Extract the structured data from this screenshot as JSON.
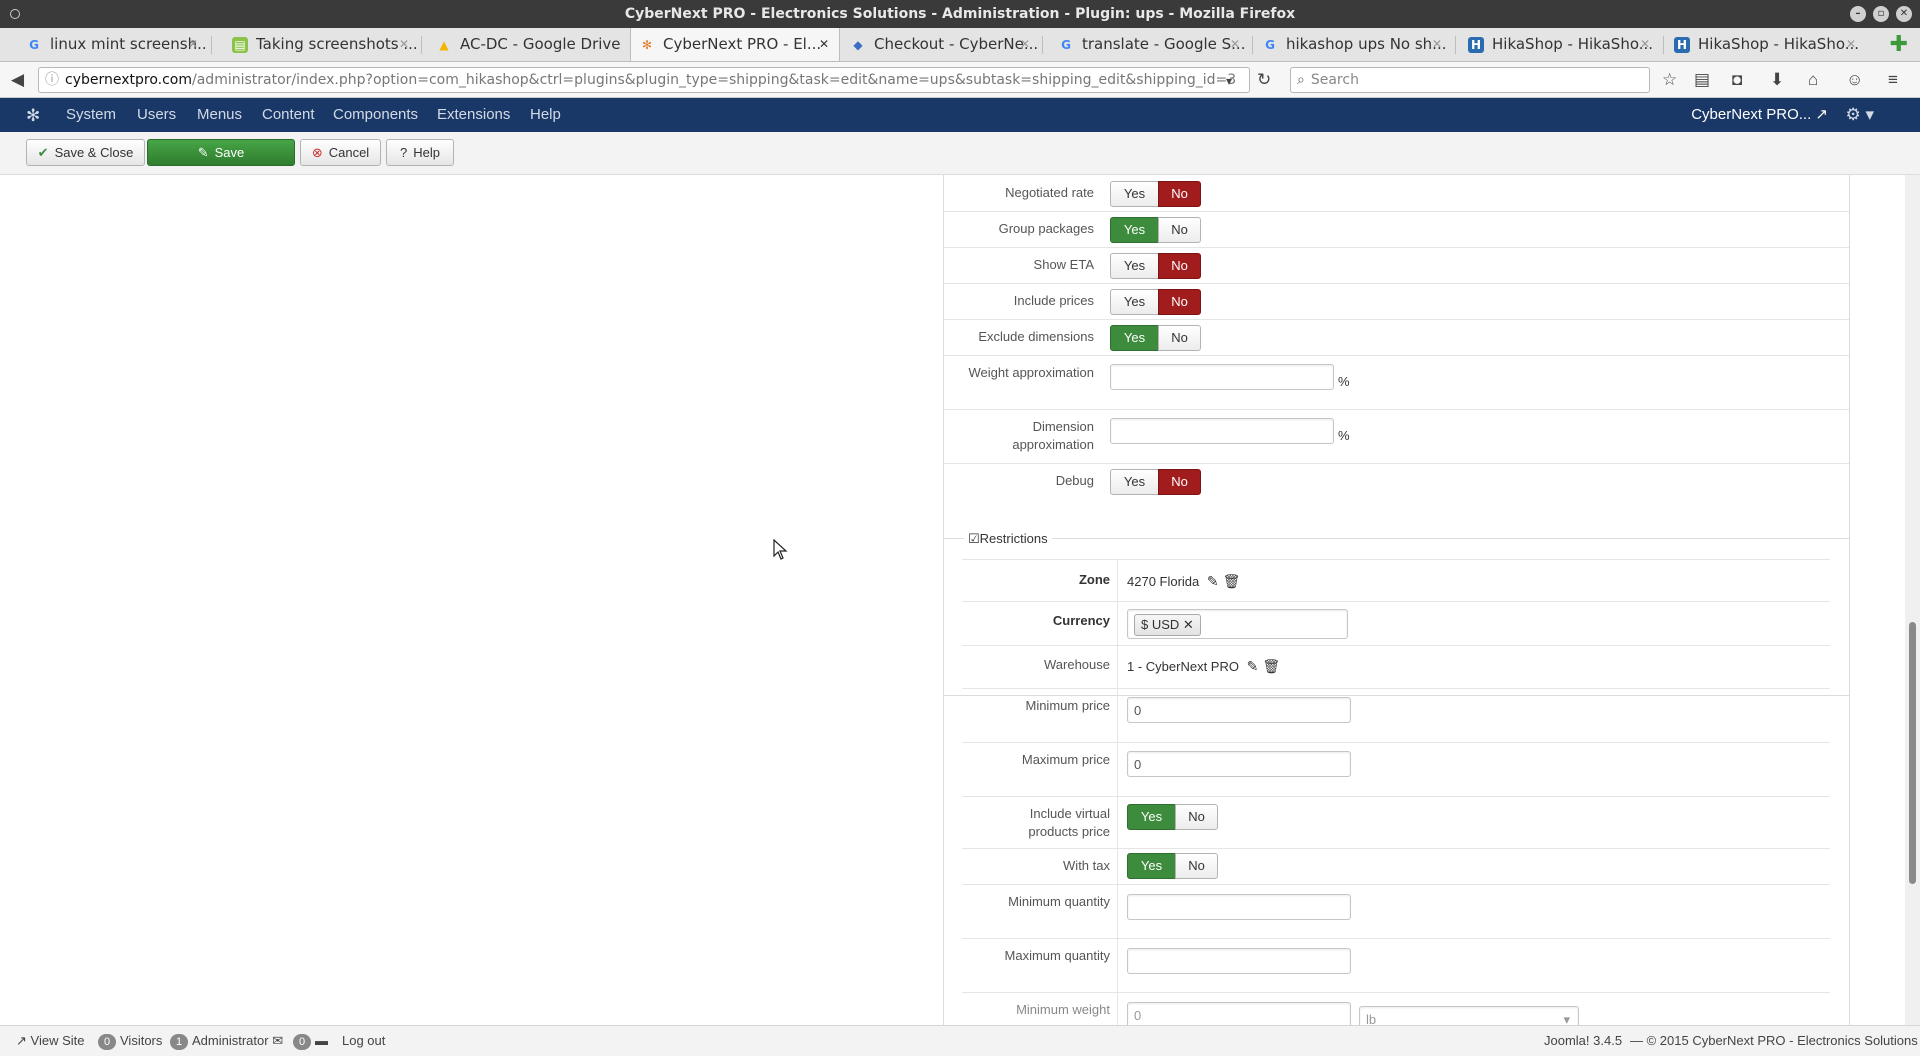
{
  "window": {
    "title": "CyberNext PRO - Electronics Solutions - Administration - Plugin: ups - Mozilla Firefox"
  },
  "tabs": [
    {
      "label": "linux mint screensh...",
      "favicon": "google-icon"
    },
    {
      "label": "Taking screenshots ...",
      "favicon": "page-icon"
    },
    {
      "label": "AC-DC - Google Drive",
      "favicon": "google-drive-icon"
    },
    {
      "label": "CyberNext PRO - El...",
      "favicon": "joomla-icon",
      "active": true
    },
    {
      "label": "Checkout - CyberNe...",
      "favicon": "cube-icon"
    },
    {
      "label": "translate - Google S...",
      "favicon": "google-icon"
    },
    {
      "label": "hikashop ups No sh...",
      "favicon": "google-icon"
    },
    {
      "label": "HikaShop - HikaSho...",
      "favicon": "hikashop-icon"
    },
    {
      "label": "HikaShop - HikaSho...",
      "favicon": "hikashop-icon"
    }
  ],
  "urlbar": {
    "host": "cybernextpro.com",
    "path": "/administrator/index.php?option=com_hikashop&ctrl=plugins&plugin_type=shipping&task=edit&name=ups&subtask=shipping_edit&shipping_id=3",
    "search_placeholder": "Search"
  },
  "admin_menu": {
    "items": [
      "System",
      "Users",
      "Menus",
      "Content",
      "Components",
      "Extensions",
      "Help"
    ],
    "site_name": "CyberNext PRO..."
  },
  "toolbar": {
    "save_close": "Save & Close",
    "save": "Save",
    "cancel": "Cancel",
    "help": "Help"
  },
  "options": {
    "negotiated_rate": {
      "label": "Negotiated rate",
      "yes": "Yes",
      "no": "No",
      "value": "No"
    },
    "group_packages": {
      "label": "Group packages",
      "yes": "Yes",
      "no": "No",
      "value": "Yes"
    },
    "show_eta": {
      "label": "Show ETA",
      "yes": "Yes",
      "no": "No",
      "value": "No"
    },
    "include_prices": {
      "label": "Include prices",
      "yes": "Yes",
      "no": "No",
      "value": "No"
    },
    "exclude_dimensions": {
      "label": "Exclude dimensions",
      "yes": "Yes",
      "no": "No",
      "value": "Yes"
    },
    "weight_approximation": {
      "label": "Weight approximation",
      "value": "",
      "unit": "%"
    },
    "dimension_approximation": {
      "label_line1": "Dimension",
      "label_line2": "approximation",
      "value": "",
      "unit": "%"
    },
    "debug": {
      "label": "Debug",
      "yes": "Yes",
      "no": "No",
      "value": "No"
    }
  },
  "restrictions": {
    "legend": "Restrictions",
    "zone": {
      "label": "Zone",
      "value": "4270 Florida"
    },
    "currency": {
      "label": "Currency",
      "chip": "$ USD"
    },
    "warehouse": {
      "label": "Warehouse",
      "value": "1 - CyberNext PRO"
    },
    "minimum_price": {
      "label": "Minimum price",
      "value": "0"
    },
    "maximum_price": {
      "label": "Maximum price",
      "value": "0"
    },
    "include_virtual": {
      "label_line1": "Include virtual",
      "label_line2": "products price",
      "yes": "Yes",
      "no": "No",
      "value": "Yes"
    },
    "with_tax": {
      "label": "With tax",
      "yes": "Yes",
      "no": "No",
      "value": "Yes"
    },
    "minimum_quantity": {
      "label": "Minimum quantity",
      "value": ""
    },
    "maximum_quantity": {
      "label": "Maximum quantity",
      "value": ""
    },
    "minimum_weight": {
      "label": "Minimum weight",
      "value": "0",
      "unit": "lb"
    }
  },
  "status": {
    "view_site": "View Site",
    "visitors_count": "0",
    "visitors_label": "Visitors",
    "admin_count": "1",
    "admin_label": "Administrator",
    "messages_count": "0",
    "logout": "Log out",
    "version": "Joomla! 3.4.5",
    "copyright": "— © 2015 CyberNext PRO - Electronics Solutions"
  }
}
